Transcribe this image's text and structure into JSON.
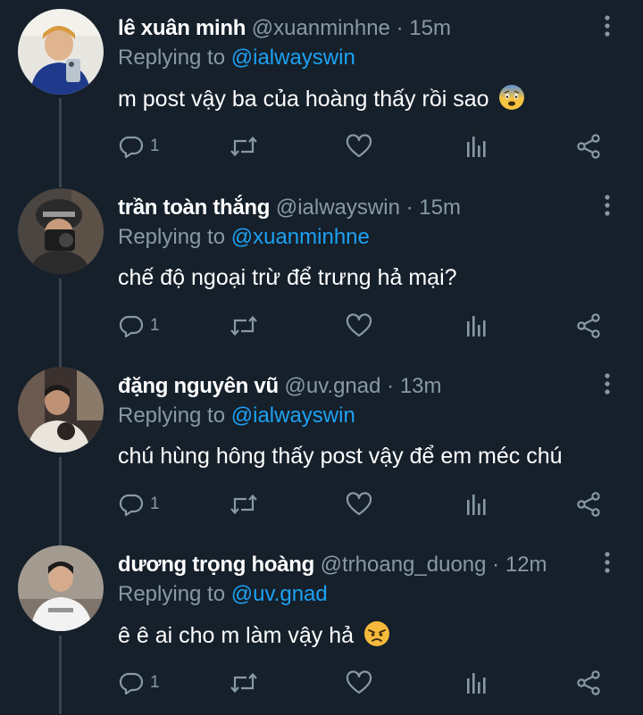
{
  "tweets": [
    {
      "name": "lê xuân minh",
      "handle": "@xuanminhne",
      "dot": "·",
      "time": "15m",
      "replying_prefix": "Replying to ",
      "replying_to": "@ialwayswin",
      "text": "m post vậy ba của hoàng thấy rồi sao",
      "emoji": "fearful-face-emoji",
      "reply_count": "1"
    },
    {
      "name": "trần toàn thắng",
      "handle": "@ialwayswin",
      "dot": "·",
      "time": "15m",
      "replying_prefix": "Replying to ",
      "replying_to": "@xuanminhne",
      "text": "chế độ ngoại trừ để trưng hả mại?",
      "emoji": "",
      "reply_count": "1"
    },
    {
      "name": "đặng nguyên vũ",
      "handle": "@uv.gnad",
      "dot": "·",
      "time": "13m",
      "replying_prefix": "Replying to ",
      "replying_to": "@ialwayswin",
      "text": "chú hùng hông thấy post vậy để em méc chú",
      "emoji": "",
      "reply_count": "1"
    },
    {
      "name": "dương trọng hoàng",
      "handle": "@trhoang_duong",
      "dot": "·",
      "time": "12m",
      "replying_prefix": "Replying to ",
      "replying_to": "@uv.gnad",
      "text": "ê ê ai cho m làm vậy hả",
      "emoji": "angry-face-emoji",
      "reply_count": "1"
    }
  ],
  "icons": [
    "reply-icon",
    "retweet-icon",
    "like-icon",
    "analytics-icon",
    "share-icon",
    "more-options-icon"
  ],
  "colors": {
    "background": "#15202b",
    "secondary_text": "#8899a6",
    "link": "#1da1f2",
    "thread_line": "#38444d"
  }
}
